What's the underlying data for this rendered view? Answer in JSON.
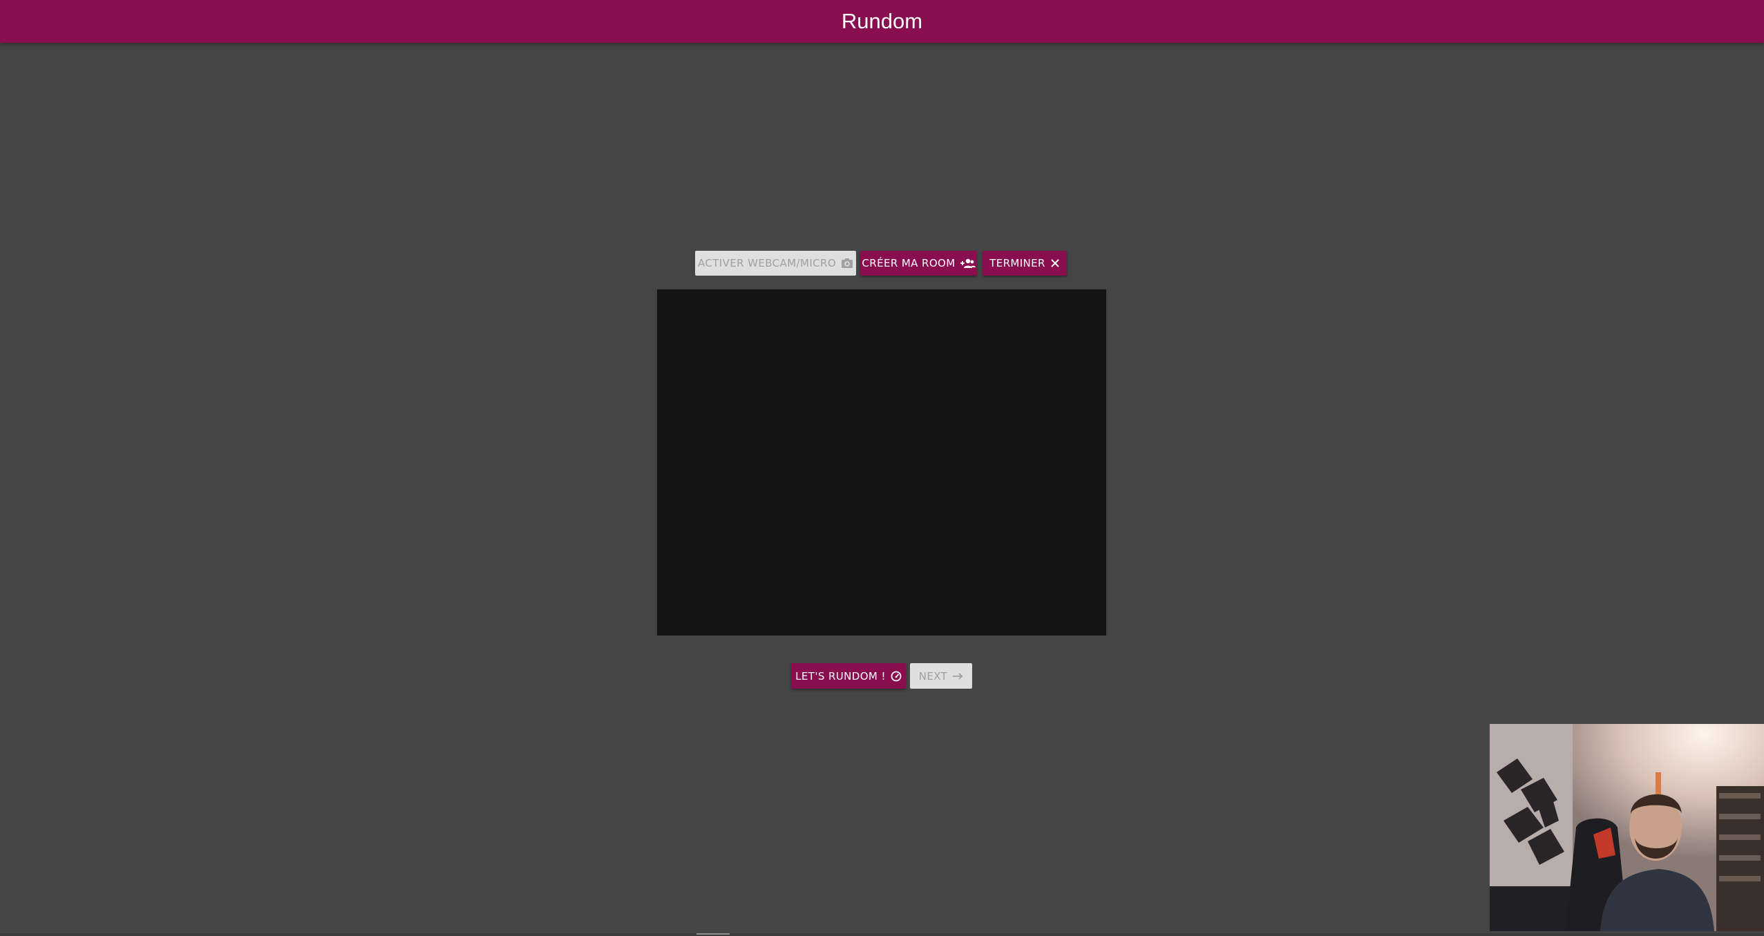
{
  "app": {
    "title": "Rundom",
    "brand_color": "#880E4F",
    "background_color": "#454545"
  },
  "controls": {
    "webcam_label": "ACTIVER WEBCAM/MICRO",
    "webcam_icon": "camera-switch-icon",
    "room_label": "CRÉER MA ROOM",
    "room_icon": "group-add-icon",
    "stop_label": "TERMINER",
    "stop_icon": "close-icon"
  },
  "actions": {
    "rundom_label": "LET'S RUNDOM !",
    "rundom_icon": "speedometer-icon",
    "next_label": "NEXT",
    "next_icon": "arrow-right-icon"
  }
}
